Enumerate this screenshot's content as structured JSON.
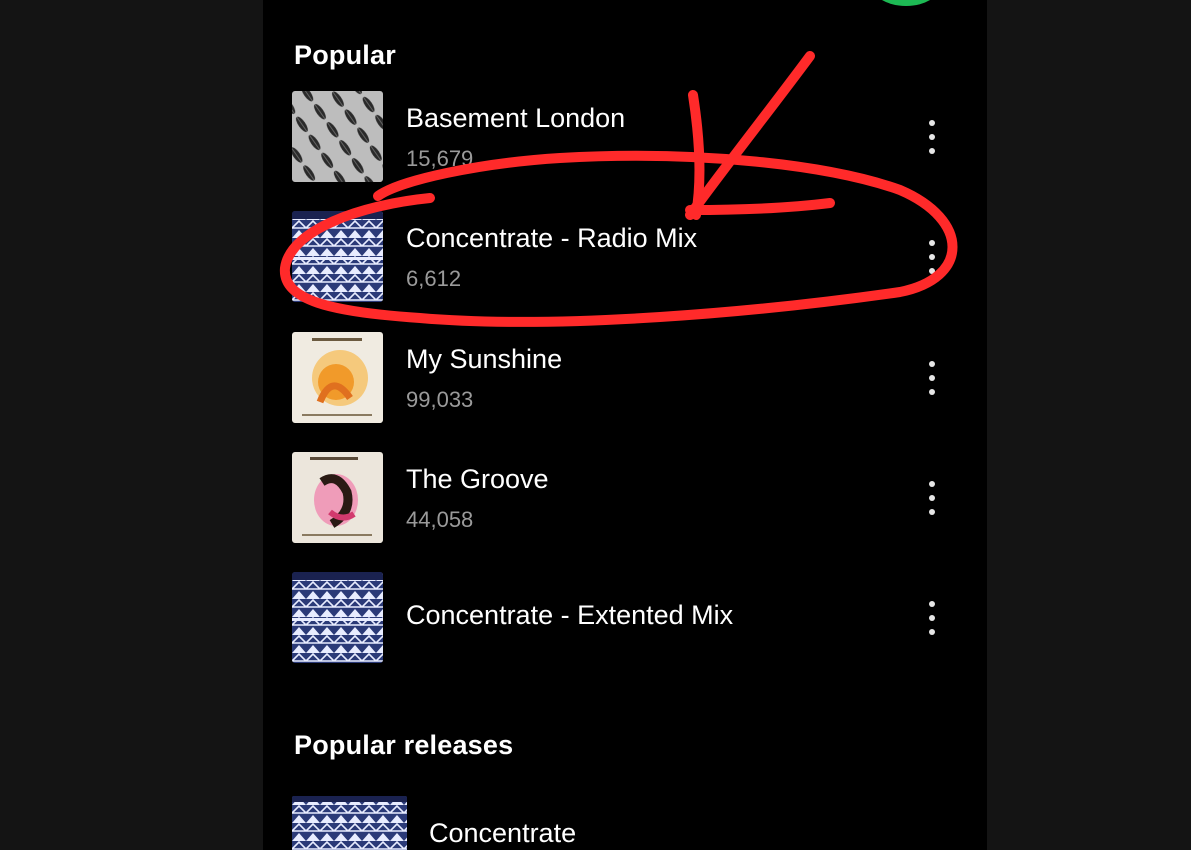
{
  "popular": {
    "heading": "Popular",
    "tracks": [
      {
        "title": "Basement London",
        "plays": "15,679",
        "art": "feather-pattern-art"
      },
      {
        "title": "Concentrate - Radio Mix",
        "plays": "6,612",
        "art": "tribal-pattern-art"
      },
      {
        "title": "My Sunshine",
        "plays": "99,033",
        "art": "my-sunshine-cover-art"
      },
      {
        "title": "The Groove",
        "plays": "44,058",
        "art": "the-groove-cover-art"
      },
      {
        "title": "Concentrate - Extented Mix",
        "plays": "",
        "art": "tribal-pattern-art"
      }
    ]
  },
  "popular_releases": {
    "heading": "Popular releases",
    "items": [
      {
        "title": "Concentrate",
        "art": "tribal-pattern-art"
      }
    ]
  },
  "colors": {
    "background": "#000000",
    "outer_background": "#141414",
    "accent_green": "#1db954",
    "annotation_red": "#ff2a2a",
    "secondary_text": "#9a9a9a"
  },
  "icons": [
    "more-vertical-icon"
  ],
  "annotation": "red hand-drawn circle and arrow marking 'Concentrate - Radio Mix'"
}
